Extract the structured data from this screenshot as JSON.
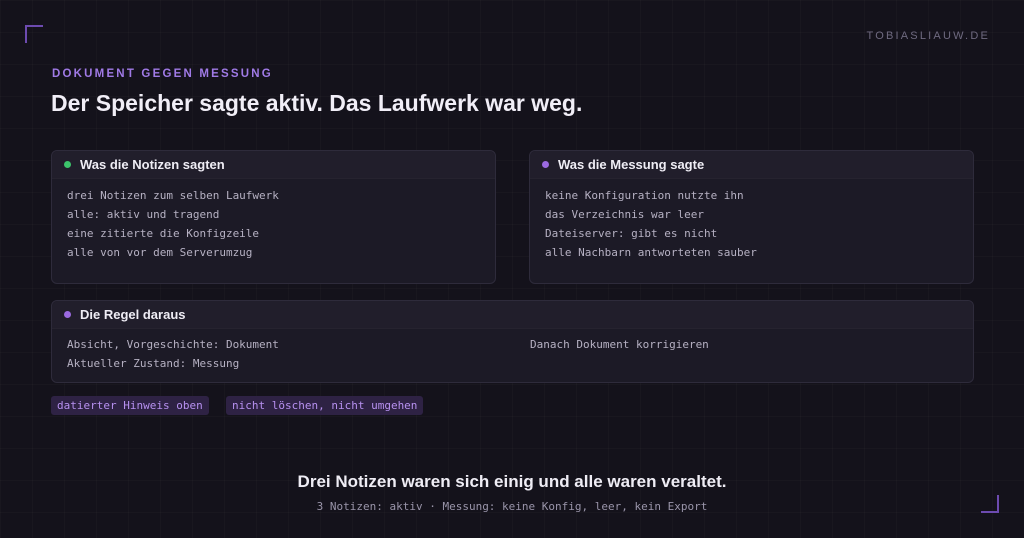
{
  "site": "TOBIASLIAUW.DE",
  "eyebrow": "DOKUMENT GEGEN MESSUNG",
  "title": "Der Speicher sagte aktiv. Das Laufwerk war weg.",
  "cards": {
    "notes": {
      "title": "Was die Notizen sagten",
      "dot_color": "#3cc46b",
      "lines": [
        "drei Notizen zum selben Laufwerk",
        "alle: aktiv und tragend",
        "eine zitierte die Konfigzeile",
        "alle von vor dem Serverumzug"
      ]
    },
    "measurement": {
      "title": "Was die Messung sagte",
      "dot_color": "#9b6ae0",
      "lines": [
        "keine Konfiguration nutzte ihn",
        "das Verzeichnis war leer",
        "Dateiserver: gibt es nicht",
        "alle Nachbarn antworteten sauber"
      ]
    },
    "rule": {
      "title": "Die Regel daraus",
      "dot_color": "#9b6ae0",
      "left_lines": [
        "Absicht, Vorgeschichte: Dokument",
        "Aktueller Zustand: Messung"
      ],
      "right_lines": [
        "Danach Dokument korrigieren"
      ]
    }
  },
  "tags": [
    "datierter Hinweis oben",
    "nicht löschen, nicht umgehen"
  ],
  "conclusion": "Drei Notizen waren sich einig und alle waren veraltet.",
  "footnote": "3 Notizen: aktiv · Messung: keine Konfig, leer, kein Export"
}
